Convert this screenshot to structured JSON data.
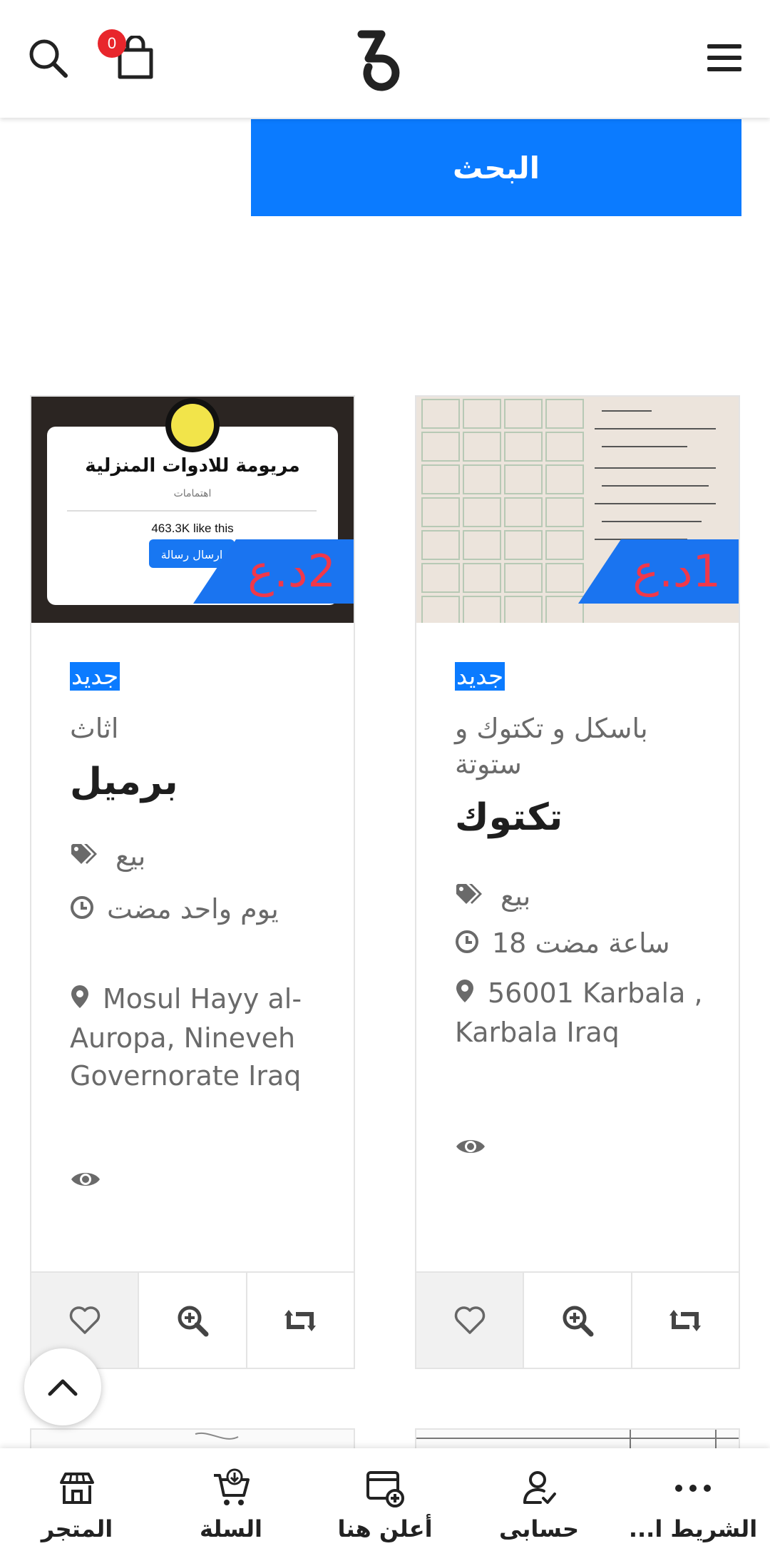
{
  "header": {
    "cart_count": "0",
    "icons": [
      "search-icon",
      "shopping-bag-icon",
      "logo",
      "hamburger-menu-icon"
    ]
  },
  "search": {
    "button_label": "البحث"
  },
  "products": [
    {
      "badge": "جديد",
      "category": "اثاث",
      "title": "برميل",
      "type": "بيع",
      "time": "يوم واحد مضت",
      "location": "Mosul Hayy al-Auropa, Nineveh Governorate Iraq",
      "price": "2د.ع",
      "image_text": {
        "store_name": "مريومة للادوات المنزلية",
        "subtitle": "اهتمامات",
        "likes": "463.3K like this",
        "message_btn": "ارسال رسالة"
      }
    },
    {
      "badge": "جديد",
      "category": "باسكل و تكتوك و ستوتة",
      "title": "تكتوك",
      "type": "بيع",
      "time": "18 ساعة مضت",
      "location": "56001 Karbala , Karbala Iraq",
      "price": "1د.ع"
    }
  ],
  "bottom_nav": [
    {
      "label": "المتجر",
      "icon": "store-icon"
    },
    {
      "label": "السلة",
      "icon": "cart-icon"
    },
    {
      "label": "أعلن هنا",
      "icon": "advertise-icon"
    },
    {
      "label": "حسابى",
      "icon": "account-icon"
    },
    {
      "label": "الشريط ا...",
      "icon": "more-dots-icon"
    }
  ],
  "colors": {
    "accent": "#0b7bff",
    "badge_red": "#e8262c",
    "price_red": "#f0384a"
  }
}
